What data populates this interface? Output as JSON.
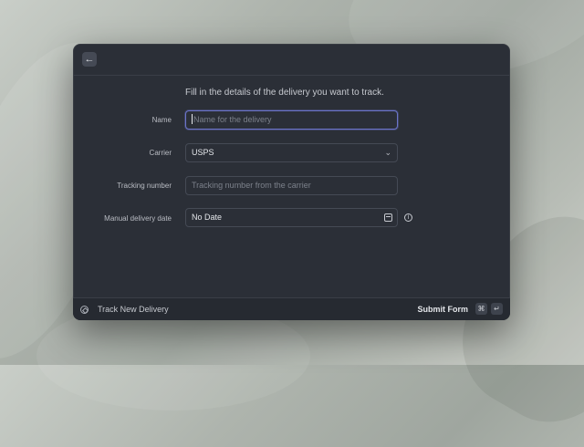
{
  "header": {
    "back_icon": "arrow-left-icon",
    "back_glyph": "←"
  },
  "form": {
    "intro": "Fill in the details of the delivery you want to track.",
    "fields": [
      {
        "label": "Name",
        "value": "",
        "placeholder": "Name for the delivery"
      },
      {
        "label": "Carrier",
        "value": "USPS",
        "icon": "chevron-down-icon",
        "glyph": "⌄"
      },
      {
        "label": "Tracking number",
        "value": "",
        "placeholder": "Tracking number from the carrier"
      },
      {
        "label": "Manual delivery date",
        "value": "No Date",
        "icon": "calendar-icon",
        "info_icon": "info-icon",
        "info_glyph": "i"
      }
    ]
  },
  "footer": {
    "app_icon": "package-icon",
    "title": "Track New Delivery",
    "submit_label": "Submit Form",
    "shortcut": [
      "⌘",
      "↵"
    ]
  },
  "colors": {
    "window_bg": "#2b2f37",
    "focus_border": "#6b74c9",
    "footer_bg": "#262a31"
  }
}
